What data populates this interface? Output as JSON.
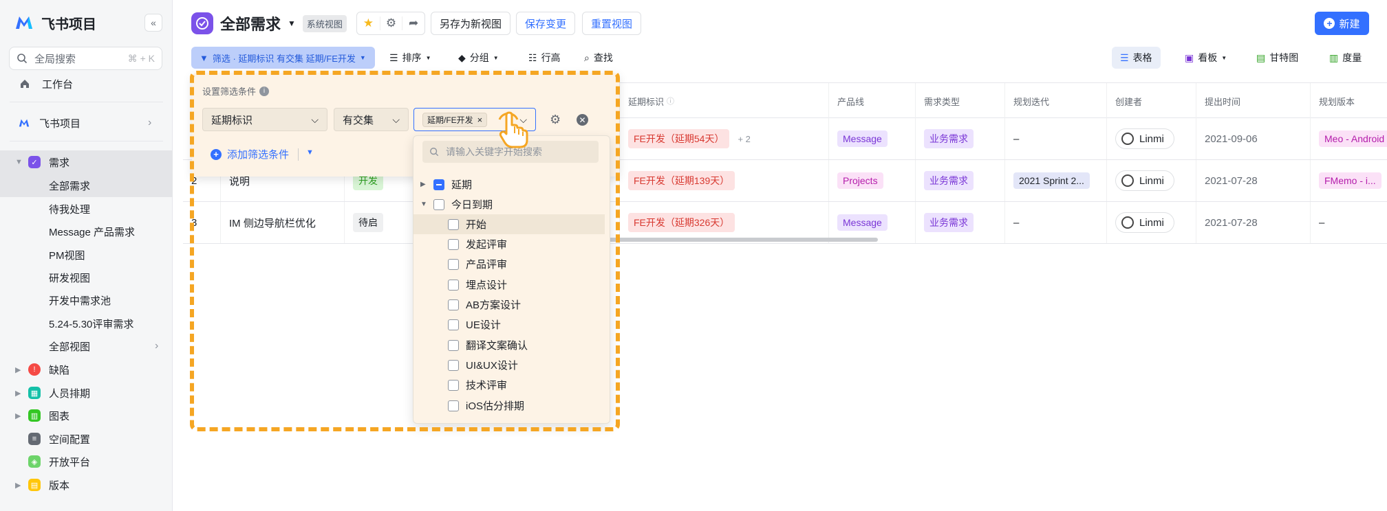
{
  "app": {
    "name": "飞书项目"
  },
  "sidebar": {
    "search_placeholder": "全局搜索",
    "search_shortcut": "⌘ + K",
    "workbench": "工作台",
    "space": "飞书项目",
    "items": [
      {
        "label": "需求",
        "color": "#7b52e9"
      },
      {
        "label": "缺陷",
        "color": "#f54a45"
      },
      {
        "label": "人员排期",
        "color": "#14c0a8"
      },
      {
        "label": "图表",
        "color": "#34c724"
      },
      {
        "label": "空间配置",
        "color": "#646a73"
      },
      {
        "label": "开放平台",
        "color": "#6dd46a"
      },
      {
        "label": "版本",
        "color": "#ffc60a"
      }
    ],
    "sub_items": [
      "全部需求",
      "待我处理",
      "Message 产品需求",
      "PM视图",
      "研发视图",
      "开发中需求池",
      "5.24-5.30评审需求",
      "全部视图"
    ]
  },
  "header": {
    "title": "全部需求",
    "badge": "系统视图",
    "save_as": "另存为新视图",
    "save_changes": "保存变更",
    "reset_view": "重置视图",
    "new_button": "新建"
  },
  "toolbar": {
    "filter_label": "筛选 · 延期标识 有交集 延期/FE开发",
    "sort": "排序",
    "group": "分组",
    "row_height": "行高",
    "find": "查找",
    "views": {
      "table": "表格",
      "board": "看板",
      "gantt": "甘特图",
      "metric": "度量"
    }
  },
  "filter_panel": {
    "title": "设置筛选条件",
    "field": "延期标识",
    "operator": "有交集",
    "value_tag": "延期/FE开发",
    "add_condition": "添加筛选条件",
    "search_placeholder": "请输入关键字开始搜索",
    "groups": [
      {
        "label": "延期",
        "state": "partial"
      },
      {
        "label": "今日到期",
        "state": "unchecked"
      }
    ],
    "options": [
      "开始",
      "发起评审",
      "产品评审",
      "埋点设计",
      "AB方案设计",
      "UE设计",
      "翻译文案确认",
      "UI&UX设计",
      "技术评审",
      "iOS估分排期"
    ]
  },
  "table": {
    "columns": [
      "延期标识",
      "产品线",
      "需求类型",
      "规划迭代",
      "创建者",
      "提出时间",
      "规划版本"
    ],
    "rows": [
      {
        "num": "",
        "name": "",
        "status": "",
        "delay": "FE开发（延期54天）",
        "delay_more": "+ 2",
        "product": "Message",
        "type": "业务需求",
        "iteration": "–",
        "creator": "Linmi",
        "date": "2021-09-06",
        "version": "Meo - Android"
      },
      {
        "num": "2",
        "name": "说明",
        "status": "开发",
        "delay": "FE开发（延期139天）",
        "delay_more": "",
        "product": "Projects",
        "type": "业务需求",
        "iteration": "2021 Sprint 2...",
        "creator": "Linmi",
        "date": "2021-07-28",
        "version": "FMemo - i..."
      },
      {
        "num": "3",
        "name": "IM 侧边导航栏优化",
        "status": "待启",
        "delay": "FE开发（延期326天）",
        "delay_more": "",
        "product": "Message",
        "type": "业务需求",
        "iteration": "–",
        "creator": "Linmi",
        "date": "2021-07-28",
        "version": "–"
      }
    ]
  }
}
